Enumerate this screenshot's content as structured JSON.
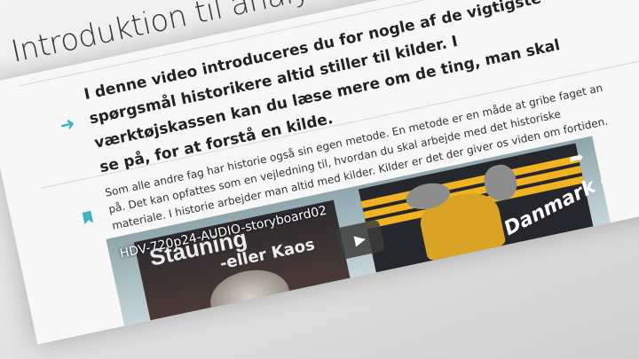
{
  "page": {
    "title": "Introduktion til analysemetode",
    "lead": "I denne video introduceres du for nogle af de vigtigste spørgsmål historikere altid stiller til kilder. I værktøjskassen kan du læse mere om de ting, man skal se på, for at forstå en kilde.",
    "body": "Som alle andre fag har historie også sin egen metode. En metode er en måde at gribe faget an på. Det kan opfattes som en vejledning til, hvordan du skal arbejde med det historiske materiale. I historie arbejder man altid med kilder. Kilder er det der giver os viden om fortiden."
  },
  "video": {
    "title": "HDV-720p24-AUDIO-storyboard02",
    "poster_left": {
      "line1": "Stauning",
      "line2": "-eller Kaos"
    },
    "poster_right": {
      "text": "Danmark op"
    },
    "play_icon": "play-icon",
    "share_icon": "share-icon"
  },
  "colors": {
    "accent": "#3bb5c0"
  }
}
